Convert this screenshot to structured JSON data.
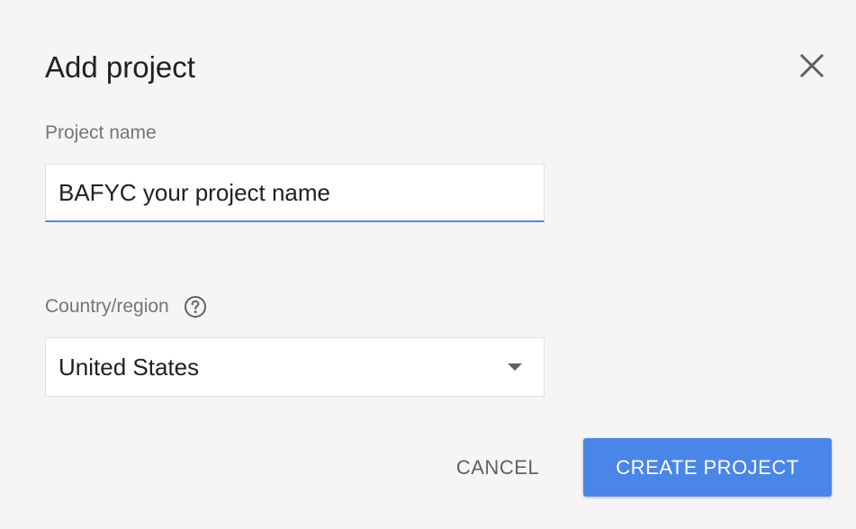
{
  "dialog": {
    "title": "Add project",
    "close_icon": "close-icon"
  },
  "project_name": {
    "label": "Project name",
    "value": "BAFYC your project name"
  },
  "country": {
    "label": "Country/region",
    "help_icon": "help-circle-icon",
    "selected": "United States",
    "dropdown_icon": "dropdown-arrow-icon"
  },
  "actions": {
    "cancel_label": "CANCEL",
    "create_label": "CREATE PROJECT"
  },
  "colors": {
    "accent": "#4a86e8",
    "background": "#f5f5f5",
    "text_primary": "#212121",
    "text_secondary": "#757575"
  }
}
